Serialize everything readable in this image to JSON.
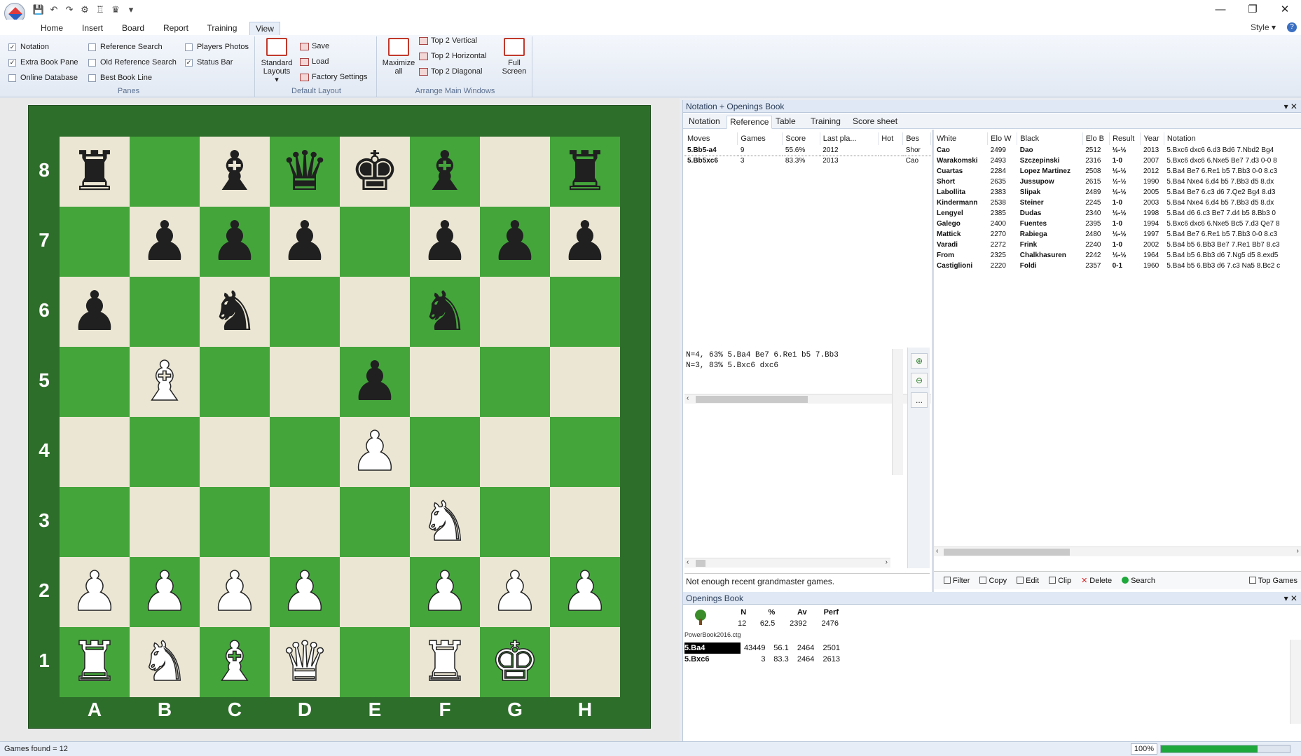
{
  "ribbon_tabs": [
    "Home",
    "Insert",
    "Board",
    "Report",
    "Training",
    "View"
  ],
  "style_label": "Style",
  "panes_group": {
    "label": "Panes",
    "checks": [
      {
        "label": "Notation",
        "checked": true
      },
      {
        "label": "Extra Book Pane",
        "checked": true
      },
      {
        "label": "Online Database",
        "checked": false
      },
      {
        "label": "Reference Search",
        "checked": false
      },
      {
        "label": "Old Reference Search",
        "checked": false
      },
      {
        "label": "Best Book Line",
        "checked": false
      },
      {
        "label": "Players Photos",
        "checked": false
      },
      {
        "label": "Status Bar",
        "checked": true
      }
    ]
  },
  "layout_group": {
    "label": "Default Layout",
    "standard": "Standard",
    "layouts": "Layouts",
    "save": "Save",
    "load": "Load",
    "factory": "Factory Settings"
  },
  "arrange_group": {
    "label": "Arrange Main Windows",
    "maximize": "Maximize",
    "all": "all",
    "top2v": "Top 2 Vertical",
    "top2h": "Top 2 Horizontal",
    "top2d": "Top 2 Diagonal",
    "full": "Full",
    "screen": "Screen"
  },
  "board": {
    "ranks": [
      "8",
      "7",
      "6",
      "5",
      "4",
      "3",
      "2",
      "1"
    ],
    "files": [
      "A",
      "B",
      "C",
      "D",
      "E",
      "F",
      "G",
      "H"
    ],
    "rows": [
      [
        "bR",
        "",
        "bB",
        "bQ",
        "bK",
        "bB",
        "",
        "bR"
      ],
      [
        "",
        "bP",
        "bP",
        "bP",
        "",
        "bP",
        "bP",
        "bP"
      ],
      [
        "bP",
        "",
        "bN",
        "",
        "",
        "bN",
        "",
        ""
      ],
      [
        "",
        "wB",
        "",
        "",
        "bP",
        "",
        "",
        ""
      ],
      [
        "",
        "",
        "",
        "",
        "wP",
        "",
        "",
        ""
      ],
      [
        "",
        "",
        "",
        "",
        "",
        "wN",
        "",
        ""
      ],
      [
        "wP",
        "wP",
        "wP",
        "wP",
        "",
        "wP",
        "wP",
        "wP"
      ],
      [
        "wR",
        "wN",
        "wB",
        "wQ",
        "",
        "wR",
        "wK",
        ""
      ]
    ]
  },
  "notation_panel": {
    "title": "Notation + Openings Book",
    "tabs": [
      "Notation",
      "Reference",
      "Table",
      "Training",
      "Score sheet"
    ],
    "moves_headers": [
      "Moves",
      "Games",
      "Score",
      "Last pla...",
      "Hot",
      "Bes"
    ],
    "moves_rows": [
      [
        "5.Bb5-a4",
        "9",
        "55.6%",
        "2012",
        "",
        "Shor"
      ],
      [
        "5.Bb5xc6",
        "3",
        "83.3%",
        "2013",
        "",
        "Cao"
      ]
    ],
    "games_headers": [
      "White",
      "Elo W",
      "Black",
      "Elo B",
      "Result",
      "Year",
      "Notation"
    ],
    "games_rows": [
      [
        "Cao",
        "2499",
        "Dao",
        "2512",
        "½-½",
        "2013",
        "5.Bxc6 dxc6 6.d3 Bd6 7.Nbd2 Bg4"
      ],
      [
        "Warakomski",
        "2493",
        "Szczepinski",
        "2316",
        "1-0",
        "2007",
        "5.Bxc6 dxc6 6.Nxe5 Be7 7.d3 0-0 8"
      ],
      [
        "Cuartas",
        "2284",
        "Lopez Martinez",
        "2508",
        "½-½",
        "2012",
        "5.Ba4 Be7 6.Re1 b5 7.Bb3 0-0 8.c3"
      ],
      [
        "Short",
        "2635",
        "Jussupow",
        "2615",
        "½-½",
        "1990",
        "5.Ba4 Nxe4 6.d4 b5 7.Bb3 d5 8.dx"
      ],
      [
        "Labollita",
        "2383",
        "Slipak",
        "2489",
        "½-½",
        "2005",
        "5.Ba4 Be7 6.c3 d6 7.Qe2 Bg4 8.d3"
      ],
      [
        "Kindermann",
        "2538",
        "Steiner",
        "2245",
        "1-0",
        "2003",
        "5.Ba4 Nxe4 6.d4 b5 7.Bb3 d5 8.dx"
      ],
      [
        "Lengyel",
        "2385",
        "Dudas",
        "2340",
        "½-½",
        "1998",
        "5.Ba4 d6 6.c3 Be7 7.d4 b5 8.Bb3 0"
      ],
      [
        "Galego",
        "2400",
        "Fuentes",
        "2395",
        "1-0",
        "1994",
        "5.Bxc6 dxc6 6.Nxe5 Bc5 7.d3 Qe7 8"
      ],
      [
        "Mattick",
        "2270",
        "Rabiega",
        "2480",
        "½-½",
        "1997",
        "5.Ba4 Be7 6.Re1 b5 7.Bb3 0-0 8.c3"
      ],
      [
        "Varadi",
        "2272",
        "Frink",
        "2240",
        "1-0",
        "2002",
        "5.Ba4 b5 6.Bb3 Be7 7.Re1 Bb7 8.c3"
      ],
      [
        "From",
        "2325",
        "Chalkhasuren",
        "2242",
        "½-½",
        "1964",
        "5.Ba4 b5 6.Bb3 d6 7.Ng5 d5 8.exd5"
      ],
      [
        "Castiglioni",
        "2220",
        "Foldi",
        "2357",
        "0-1",
        "1960",
        "5.Ba4 b5 6.Bb3 d6 7.c3 Na5 8.Bc2 c"
      ]
    ],
    "info_lines": [
      "N=4, 63%  5.Ba4 Be7 6.Re1 b5 7.Bb3",
      "N=3, 83%  5.Bxc6 dxc6"
    ],
    "status_msg": "Not enough recent grandmaster games.",
    "toolbar": [
      "Filter",
      "Copy",
      "Edit",
      "Clip",
      "Delete",
      "Search"
    ],
    "top_games": "Top Games",
    "zoom_more": "..."
  },
  "book_panel": {
    "title": "Openings Book",
    "headers": [
      "N",
      "%",
      "Av",
      "Perf"
    ],
    "book_name": "PowerBook2016.ctg",
    "summary": [
      "12",
      "62.5",
      "2392",
      "2476"
    ],
    "rows": [
      [
        "5.Ba4",
        "43449",
        "56.1",
        "2464",
        "2501"
      ],
      [
        "5.Bxc6",
        "3",
        "83.3",
        "2464",
        "2613"
      ]
    ]
  },
  "statusbar": {
    "text": "Games found = 12",
    "zoom": "100%",
    "progress": 0.75
  },
  "colors": {
    "dark_square": "#44a53b",
    "light_square": "#ebe6d3",
    "frame": "#2e6e2b",
    "accent": "#1e5bb8"
  }
}
